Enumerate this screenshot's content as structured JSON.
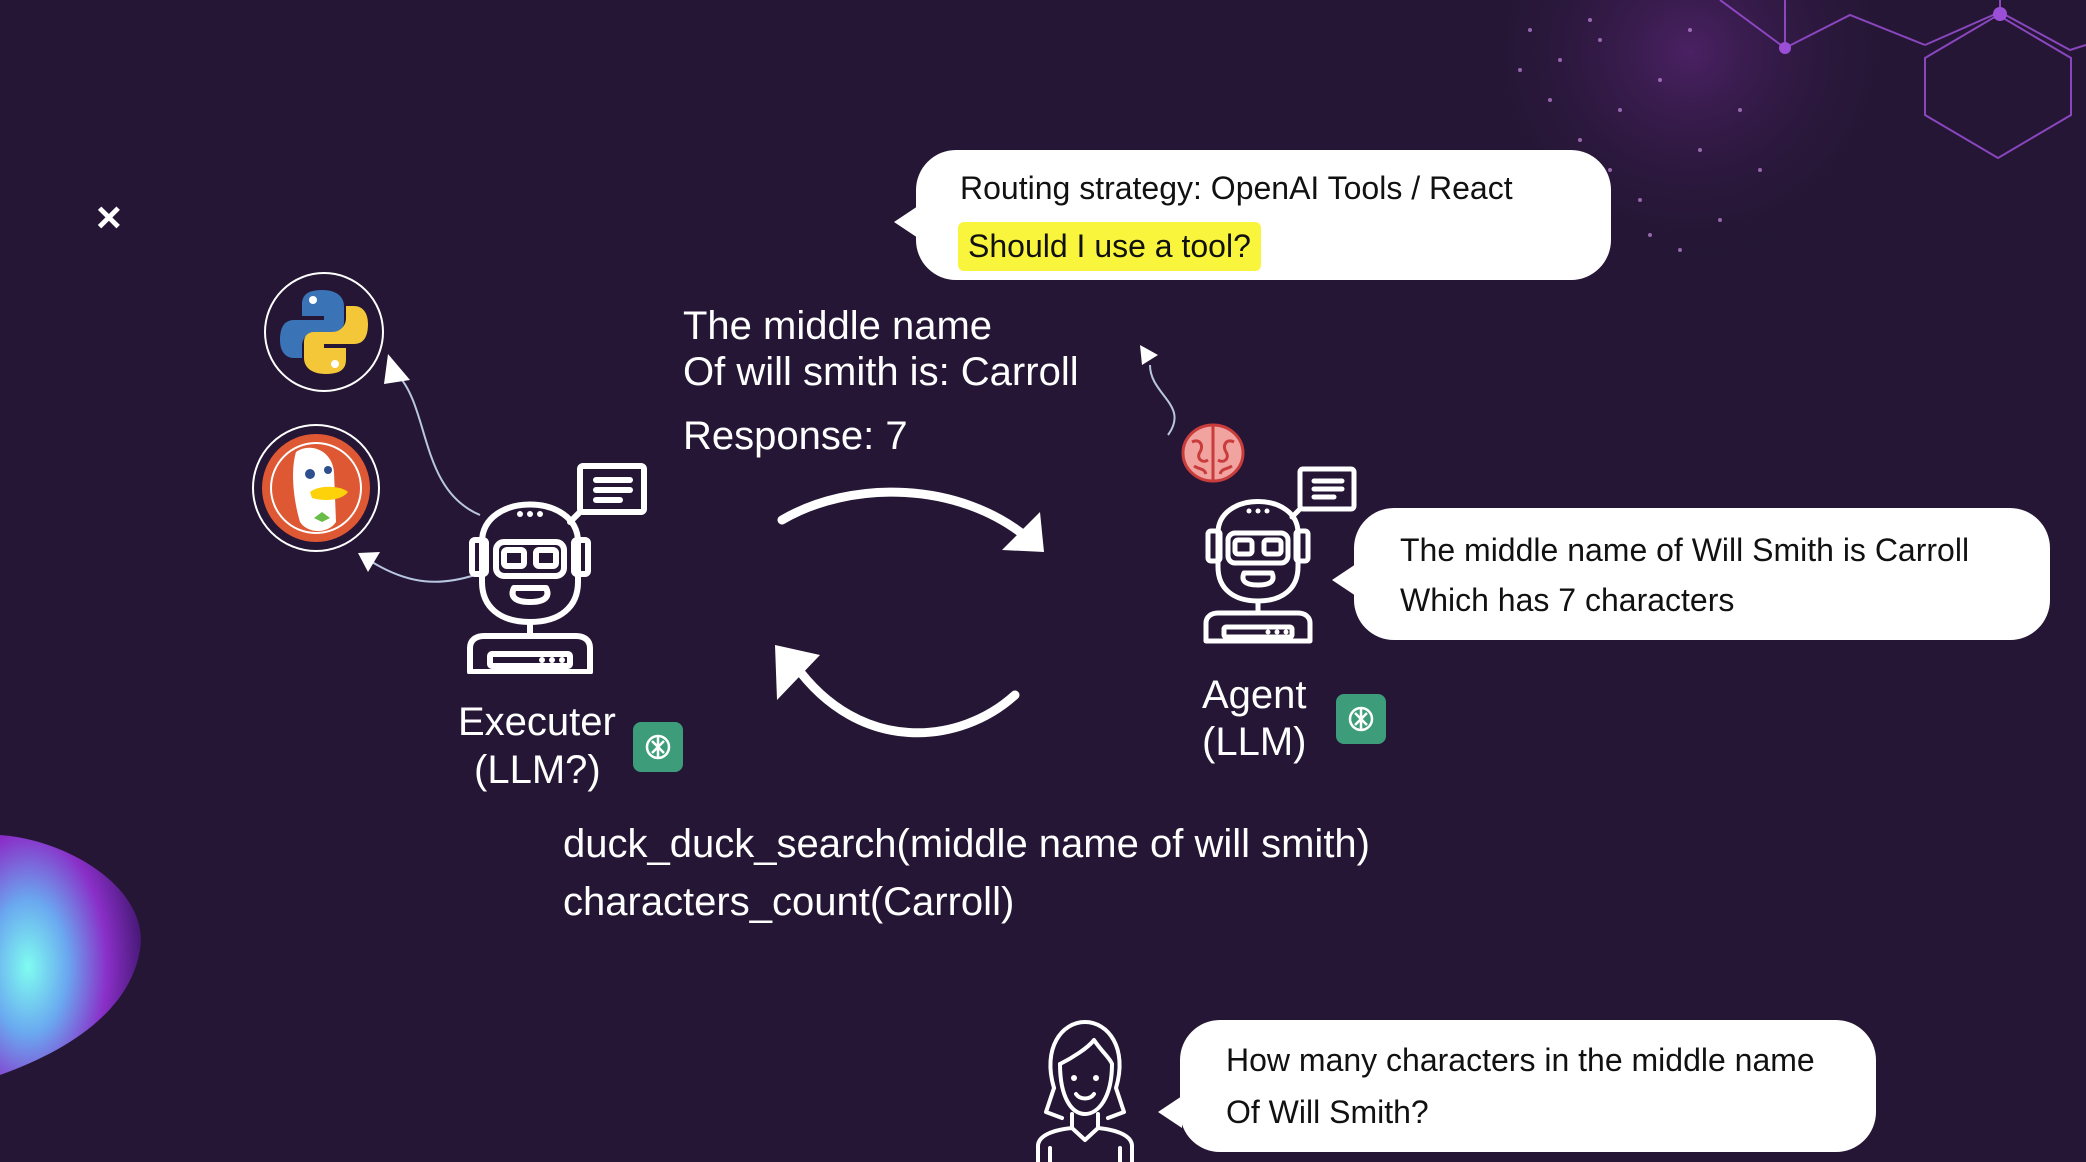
{
  "routing_bubble": {
    "line1": "Routing strategy: OpenAI Tools / React",
    "line2": "Should I use a tool?"
  },
  "response_text": {
    "line1": "The middle name",
    "line2": "Of will smith is: Carroll",
    "line3": "Response: 7"
  },
  "executer": {
    "line1": "Executer",
    "line2": "(LLM?)"
  },
  "agent": {
    "line1": "Agent",
    "line2": "(LLM)"
  },
  "agent_bubble": {
    "line1": "The middle name of Will Smith is Carroll",
    "line2": "Which has 7 characters"
  },
  "tool_calls": {
    "line1": "duck_duck_search(middle name of will smith)",
    "line2": "characters_count(Carroll)"
  },
  "user_bubble": {
    "line1": "How many characters in the middle name",
    "line2": "Of Will Smith?"
  },
  "close_glyph": "×",
  "icons": [
    "close-icon",
    "python-logo-icon",
    "duckduckgo-logo-icon",
    "robot-icon",
    "brain-icon",
    "chatgpt-icon",
    "user-icon",
    "cycle-arrow-icon"
  ],
  "colors": {
    "background": "#241634",
    "highlight": "#f8f53c",
    "chatgpt_badge": "#3d9d7a",
    "accent_purple": "#9b4fd6"
  }
}
